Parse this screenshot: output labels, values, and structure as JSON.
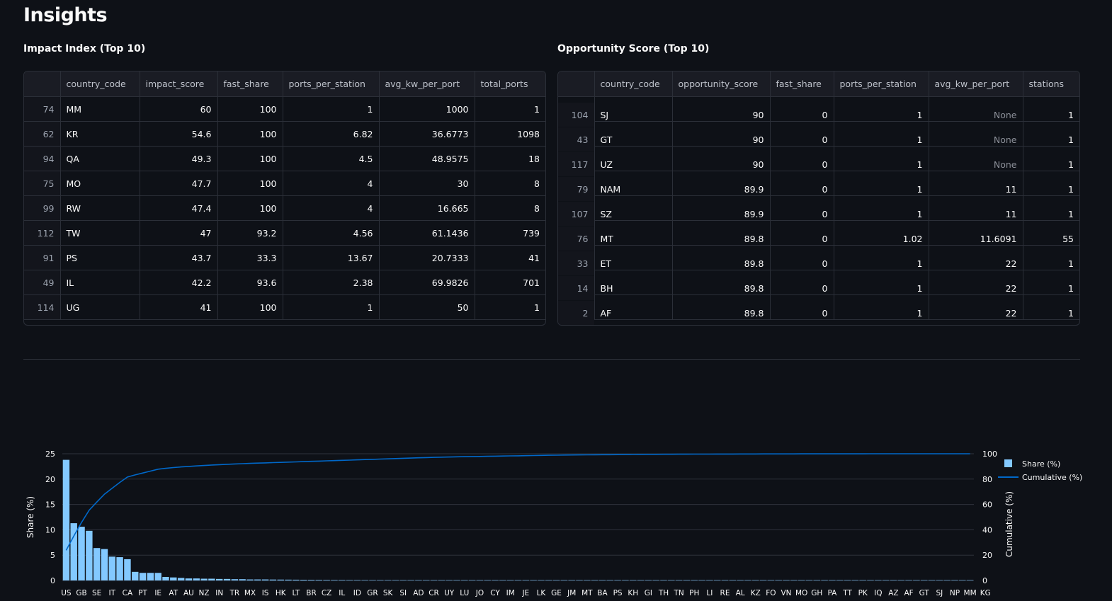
{
  "page": {
    "title": "Insights"
  },
  "impact": {
    "title": "Impact Index (Top 10)",
    "columns": [
      "",
      "country_code",
      "impact_score",
      "fast_share",
      "ports_per_station",
      "avg_kw_per_port",
      "total_ports"
    ],
    "rows": [
      [
        "74",
        "MM",
        "60",
        "100",
        "1",
        "1000",
        "1"
      ],
      [
        "62",
        "KR",
        "54.6",
        "100",
        "6.82",
        "36.6773",
        "1098"
      ],
      [
        "94",
        "QA",
        "49.3",
        "100",
        "4.5",
        "48.9575",
        "18"
      ],
      [
        "75",
        "MO",
        "47.7",
        "100",
        "4",
        "30",
        "8"
      ],
      [
        "99",
        "RW",
        "47.4",
        "100",
        "4",
        "16.665",
        "8"
      ],
      [
        "112",
        "TW",
        "47",
        "93.2",
        "4.56",
        "61.1436",
        "739"
      ],
      [
        "91",
        "PS",
        "43.7",
        "33.3",
        "13.67",
        "20.7333",
        "41"
      ],
      [
        "49",
        "IL",
        "42.2",
        "93.6",
        "2.38",
        "69.9826",
        "701"
      ],
      [
        "114",
        "UG",
        "41",
        "100",
        "1",
        "50",
        "1"
      ]
    ]
  },
  "opportunity": {
    "title": "Opportunity Score (Top 10)",
    "columns": [
      "",
      "country_code",
      "opportunity_score",
      "fast_share",
      "ports_per_station",
      "avg_kw_per_port",
      "stations"
    ],
    "rows": [
      [
        "104",
        "SJ",
        "90",
        "0",
        "1",
        "None",
        "1"
      ],
      [
        "43",
        "GT",
        "90",
        "0",
        "1",
        "None",
        "1"
      ],
      [
        "117",
        "UZ",
        "90",
        "0",
        "1",
        "None",
        "1"
      ],
      [
        "79",
        "NAM",
        "89.9",
        "0",
        "1",
        "11",
        "1"
      ],
      [
        "107",
        "SZ",
        "89.9",
        "0",
        "1",
        "11",
        "1"
      ],
      [
        "76",
        "MT",
        "89.8",
        "0",
        "1.02",
        "11.6091",
        "55"
      ],
      [
        "33",
        "ET",
        "89.8",
        "0",
        "1",
        "22",
        "1"
      ],
      [
        "14",
        "BH",
        "89.8",
        "0",
        "1",
        "22",
        "1"
      ],
      [
        "2",
        "AF",
        "89.8",
        "0",
        "1",
        "22",
        "1"
      ]
    ]
  },
  "chart_data": {
    "type": "bar",
    "title": "",
    "xlabel": "",
    "ylabel": "Share (%)",
    "y2label": "Cumulative (%)",
    "ylim": [
      0,
      25
    ],
    "y2lim": [
      0,
      100
    ],
    "yticks": [
      0,
      5,
      10,
      15,
      20,
      25
    ],
    "y2ticks": [
      0,
      20,
      40,
      60,
      80,
      100
    ],
    "grid": true,
    "legend_position": "top-right",
    "colors": {
      "bar": "#83c9ff",
      "line": "#0068c9",
      "grid": "#2f333c",
      "text": "#fafafa"
    },
    "tick_labels": [
      "US",
      "GB",
      "SE",
      "IT",
      "CA",
      "PT",
      "IE",
      "AT",
      "AU",
      "NZ",
      "IN",
      "TR",
      "MX",
      "IS",
      "HK",
      "LT",
      "BR",
      "CZ",
      "IL",
      "ID",
      "GR",
      "SK",
      "SI",
      "AD",
      "CR",
      "UY",
      "LU",
      "JO",
      "CY",
      "IM",
      "JE",
      "LK",
      "GE",
      "JM",
      "MT",
      "BA",
      "PS",
      "KH",
      "GI",
      "TH",
      "TN",
      "PH",
      "LI",
      "RE",
      "AL",
      "KZ",
      "FO",
      "VN",
      "MO",
      "GH",
      "PA",
      "TT",
      "PK",
      "IQ",
      "AZ",
      "AF",
      "GT",
      "SJ",
      "NP",
      "MM",
      "KG"
    ],
    "series": [
      {
        "name": "Share (%)",
        "type": "bar",
        "values": [
          23.8,
          11.3,
          10.6,
          9.8,
          6.4,
          6.2,
          4.7,
          4.6,
          4.2,
          1.7,
          1.5,
          1.5,
          1.5,
          0.7,
          0.6,
          0.5,
          0.4,
          0.4,
          0.35,
          0.35,
          0.3,
          0.3,
          0.25,
          0.25,
          0.2,
          0.2,
          0.2,
          0.18,
          0.17,
          0.16,
          0.15,
          0.14,
          0.13,
          0.12,
          0.11,
          0.1,
          0.1,
          0.09,
          0.09,
          0.08,
          0.08,
          0.07,
          0.07,
          0.06,
          0.06,
          0.05,
          0.05,
          0.05,
          0.04,
          0.04,
          0.04,
          0.04,
          0.03,
          0.03,
          0.03,
          0.03,
          0.03,
          0.03,
          0.03,
          0.03,
          0.02,
          0.02,
          0.02,
          0.02,
          0.02,
          0.02,
          0.02,
          0.02,
          0.02,
          0.02,
          0.02,
          0.02,
          0.02,
          0.02,
          0.01,
          0.01,
          0.01,
          0.01,
          0.01,
          0.01,
          0.01,
          0.01,
          0.01,
          0.01,
          0.01,
          0.01,
          0.01,
          0.01,
          0.01,
          0.01,
          0.01,
          0.01,
          0.01,
          0.01,
          0.01,
          0.01,
          0.01,
          0.01,
          0.01,
          0.01,
          0.01,
          0.01,
          0.01,
          0.01,
          0.01,
          0.01,
          0.01,
          0.01,
          0.01,
          0.01,
          0.01,
          0.01,
          0.01,
          0.01,
          0.01,
          0.01,
          0.01,
          0.01,
          0.01
        ]
      },
      {
        "name": "Cumulative (%)",
        "type": "line",
        "values": [
          23.8,
          35.1,
          45.7,
          55.5,
          61.9,
          68.1,
          72.8,
          77.4,
          81.6,
          83.3,
          84.8,
          86.3,
          87.8,
          88.5,
          89.1,
          89.6,
          90.0,
          90.4,
          90.75,
          91.1,
          91.4,
          91.7,
          91.95,
          92.2,
          92.4,
          92.6,
          92.8,
          93.0,
          93.2,
          93.4,
          93.6,
          93.8,
          94.0,
          94.2,
          94.4,
          94.6,
          94.8,
          95.0,
          95.2,
          95.4,
          95.6,
          95.8,
          96.0,
          96.2,
          96.4,
          96.6,
          96.8,
          97.0,
          97.15,
          97.3,
          97.45,
          97.6,
          97.7,
          97.8,
          97.9,
          98.0,
          98.1,
          98.2,
          98.3,
          98.4,
          98.5,
          98.6,
          98.7,
          98.8,
          98.9,
          99.0,
          99.05,
          99.1,
          99.15,
          99.2,
          99.25,
          99.3,
          99.35,
          99.4,
          99.45,
          99.5,
          99.53,
          99.56,
          99.59,
          99.62,
          99.65,
          99.68,
          99.7,
          99.72,
          99.74,
          99.76,
          99.78,
          99.8,
          99.82,
          99.84,
          99.86,
          99.87,
          99.88,
          99.89,
          99.9,
          99.91,
          99.92,
          99.93,
          99.94,
          99.95,
          99.95,
          99.96,
          99.96,
          99.97,
          99.97,
          99.98,
          99.98,
          99.98,
          99.99,
          99.99,
          99.99,
          99.99,
          100,
          100,
          100,
          100,
          100,
          100,
          100
        ]
      }
    ]
  }
}
